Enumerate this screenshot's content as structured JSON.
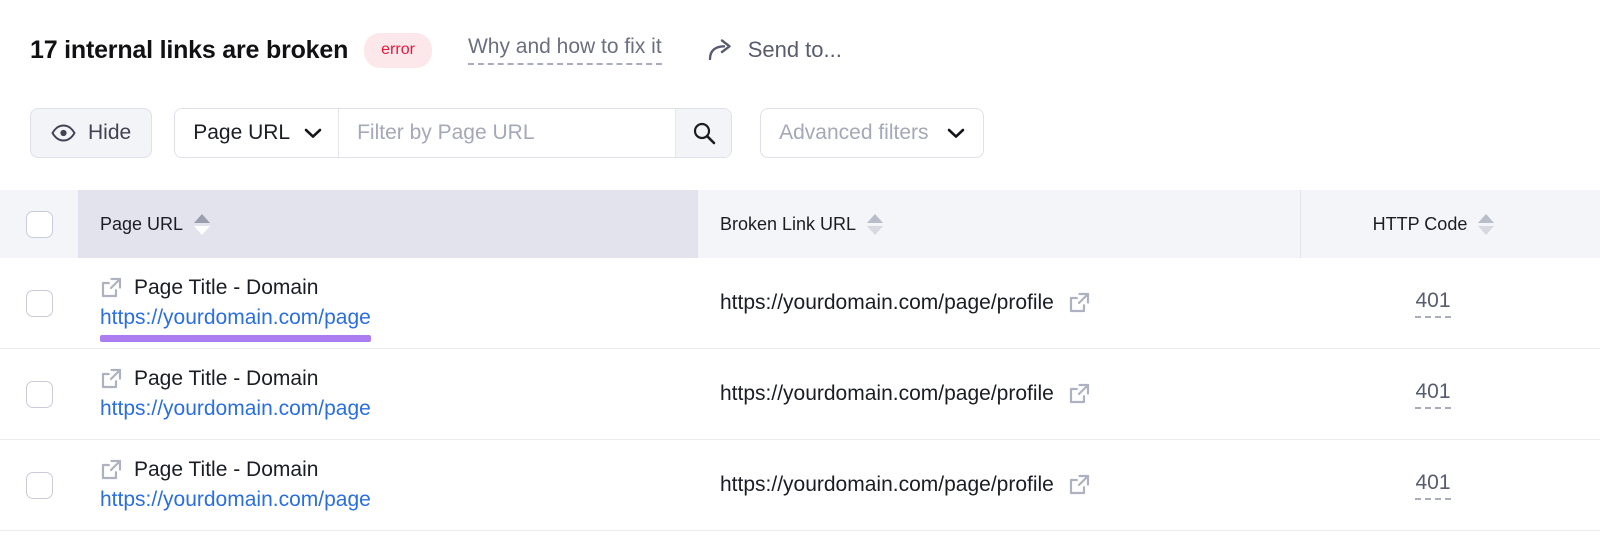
{
  "header": {
    "title": "17 internal links are broken",
    "badge": "error",
    "badge_color": "#e5173f",
    "badge_bg": "#fce8ea",
    "why_link": "Why and how to fix it",
    "send_to": "Send to...",
    "send_to_icon": "share-arrow-icon"
  },
  "filters": {
    "hide_button": "Hide",
    "hide_icon": "eye-icon",
    "select_value": "Page URL",
    "select_icon": "chevron-down-icon",
    "search_placeholder": "Filter by Page URL",
    "search_value": "",
    "search_icon": "search-icon",
    "advanced_label": "Advanced filters",
    "advanced_icon": "chevron-down-icon"
  },
  "table": {
    "columns": [
      {
        "label": "Page URL",
        "sorted": true
      },
      {
        "label": "Broken Link URL",
        "sorted": false
      },
      {
        "label": "HTTP Code",
        "sorted": false
      }
    ],
    "highlight_color": "#ab7df0",
    "rows": [
      {
        "page_title": "Page Title - Domain",
        "page_url": "https://yourdomain.com/page",
        "broken_link_url": "https://yourdomain.com/page/profile",
        "http_code": "401",
        "highlighted": true
      },
      {
        "page_title": "Page Title - Domain",
        "page_url": "https://yourdomain.com/page",
        "broken_link_url": "https://yourdomain.com/page/profile",
        "http_code": "401",
        "highlighted": false
      },
      {
        "page_title": "Page Title - Domain",
        "page_url": "https://yourdomain.com/page",
        "broken_link_url": "https://yourdomain.com/page/profile",
        "http_code": "401",
        "highlighted": false
      }
    ]
  }
}
